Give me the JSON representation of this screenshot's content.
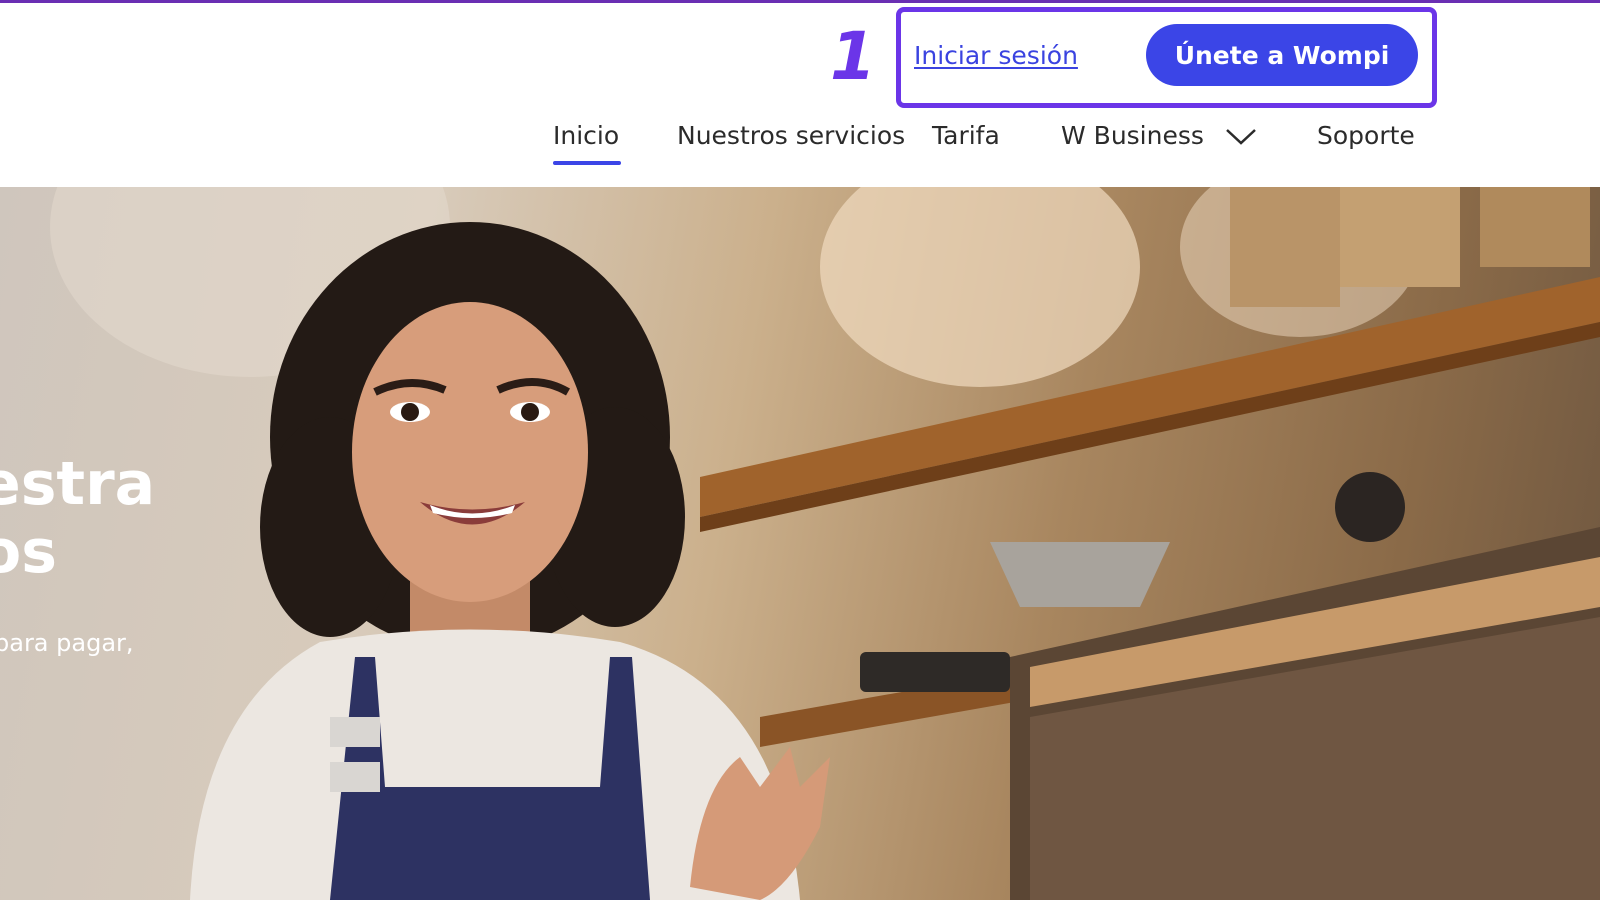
{
  "header": {
    "step_number": "1",
    "login_label": "Iniciar sesión",
    "join_label": "Únete a Wompi",
    "highlight_color": "#6b35e8",
    "accent_color": "#3b45e7"
  },
  "nav": {
    "items": [
      {
        "label": "Inicio",
        "active": true
      },
      {
        "label": "Nuestros servicios"
      },
      {
        "label": "Tarifa"
      },
      {
        "label": "W Business",
        "icon": "chevron-down-icon"
      },
      {
        "label": "Soporte"
      }
    ]
  },
  "hero": {
    "title_line_1": "estra",
    "title_line_2": "os",
    "subtitle": "para pagar,",
    "image": "smiling barista in apron in coffee shop"
  }
}
